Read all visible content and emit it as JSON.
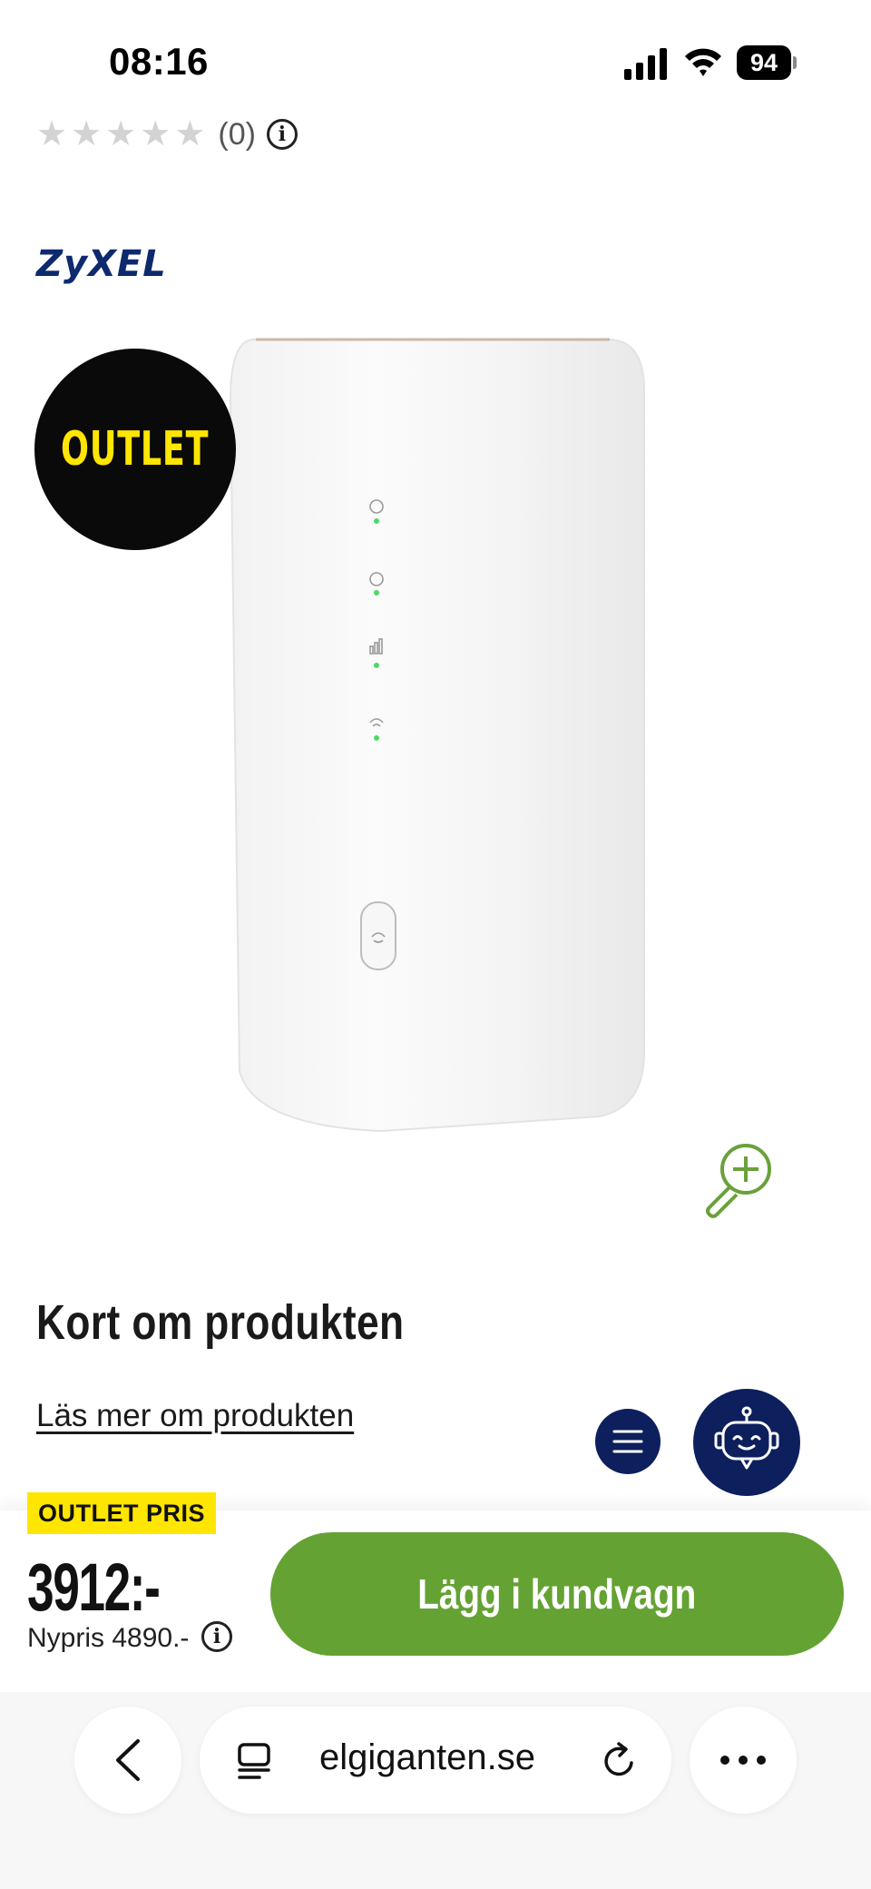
{
  "status_bar": {
    "time": "08:16",
    "battery": "94"
  },
  "rating": {
    "stars": [
      "★",
      "★",
      "★",
      "★",
      "★"
    ],
    "count": "(0)",
    "info_glyph": "i"
  },
  "product": {
    "brand": "ZyXEL",
    "outlet_badge": "OUTLET"
  },
  "about": {
    "title": "Kort om produkten",
    "read_more": "Läs mer om produkten"
  },
  "buy_bar": {
    "outlet_tag": "OUTLET PRIS",
    "price": "3912:-",
    "old_price": "Nypris 4890.-",
    "info_glyph": "i",
    "add_to_cart": "Lägg i kundvagn"
  },
  "browser": {
    "url": "elgiganten.se"
  },
  "colors": {
    "accent_green": "#64a233",
    "outlet_yellow": "#ffe600",
    "navy": "#0d1f5c",
    "brand_blue": "#0d2a6e"
  },
  "icons": [
    "signal-icon",
    "wifi-icon",
    "battery-icon",
    "info-icon",
    "zoom-in-icon",
    "menu-icon",
    "chatbot-icon",
    "back-arrow-icon",
    "tabs-icon",
    "reload-icon",
    "more-icon"
  ]
}
